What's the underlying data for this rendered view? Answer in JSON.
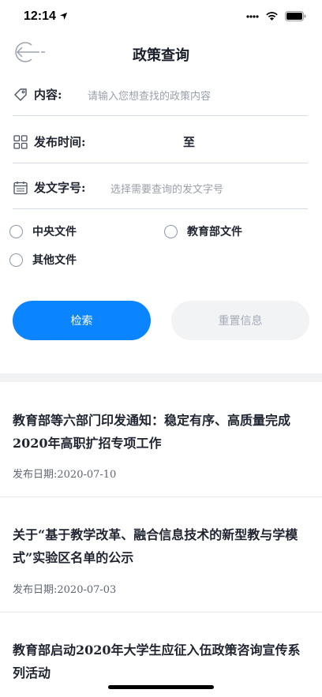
{
  "status": {
    "time": "12:14"
  },
  "header": {
    "title": "政策查询"
  },
  "form": {
    "content_label": "内容:",
    "content_placeholder": "请输入您想查找的政策内容",
    "time_label": "发布时间:",
    "time_separator": "至",
    "doc_label": "发文字号:",
    "doc_placeholder": "选择需要查询的发文字号"
  },
  "filters": [
    {
      "label": "中央文件"
    },
    {
      "label": "教育部文件"
    },
    {
      "label": "其他文件"
    }
  ],
  "buttons": {
    "search": "检索",
    "reset": "重置信息"
  },
  "news": [
    {
      "title": "教育部等六部门印发通知：稳定有序、高质量完成2020年高职扩招专项工作",
      "date": "发布日期:2020-07-10"
    },
    {
      "title": "关于“基于教学改革、融合信息技术的新型教与学模式”实验区名单的公示",
      "date": "发布日期:2020-07-03"
    },
    {
      "title": "教育部启动2020年大学生应征入伍政策咨询宣传系列活动",
      "date": ""
    }
  ],
  "colors": {
    "accent": "#0a84ff",
    "reset_bg": "#f2f3f5",
    "divider": "#d6dae3"
  }
}
